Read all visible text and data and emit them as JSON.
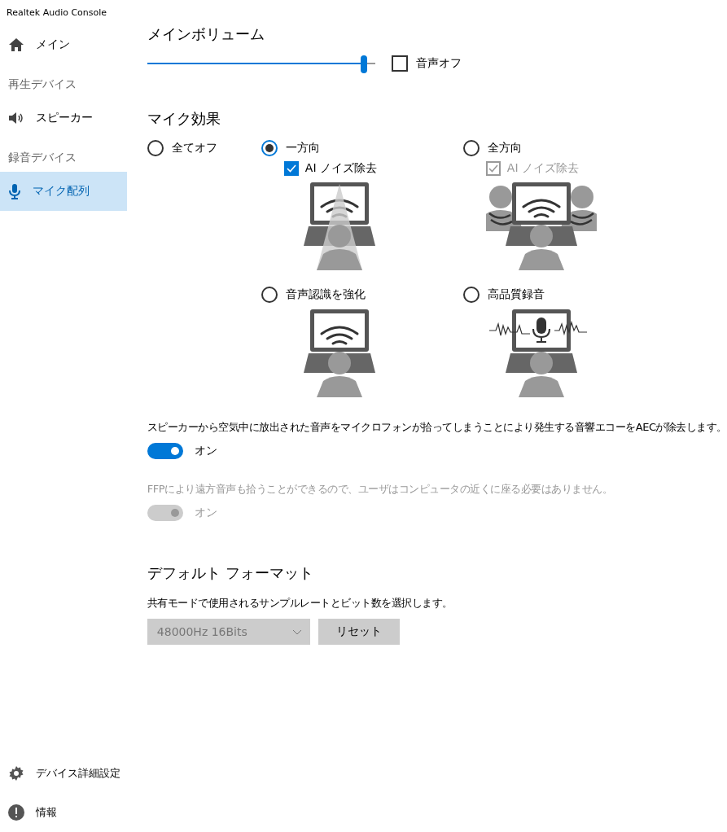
{
  "app_title": "Realtek Audio Console",
  "sidebar": {
    "items": [
      {
        "kind": "nav",
        "label": "メイン",
        "selected": false
      },
      {
        "kind": "header",
        "label": "再生デバイス"
      },
      {
        "kind": "nav",
        "label": "スピーカー",
        "selected": false
      },
      {
        "kind": "header",
        "label": "録音デバイス"
      },
      {
        "kind": "nav",
        "label": "マイク配列",
        "selected": true
      }
    ],
    "bottom_items": [
      {
        "label": "デバイス詳細設定"
      },
      {
        "label": "情報"
      }
    ]
  },
  "main_volume": {
    "title": "メインボリューム",
    "level": 0.95,
    "mute": {
      "label": "音声オフ",
      "checked": false
    }
  },
  "mic_effects": {
    "title": "マイク効果",
    "options": [
      {
        "kind": "plain",
        "label": "全てオフ",
        "selected": false
      },
      {
        "kind": "beam",
        "label": "一方向",
        "selected": true,
        "noise": {
          "label": "AI ノイズ除去",
          "checked": true,
          "disabled": false
        }
      },
      {
        "kind": "group",
        "label": "全方向",
        "selected": false,
        "noise": {
          "label": "AI ノイズ除去",
          "checked": true,
          "disabled": true
        }
      },
      {
        "kind": "waves",
        "label": "音声認識を強化",
        "selected": false
      },
      {
        "kind": "mic",
        "label": "高品質録音",
        "selected": false
      }
    ]
  },
  "toggles": [
    {
      "description": "スピーカーから空気中に放出された音声をマイクロフォンが拾ってしまうことにより発生する音響エコーをAECが除去します。",
      "label": "オン",
      "on": true,
      "disabled": false
    },
    {
      "description": "FFPにより遠方音声も拾うことができるので、ユーザはコンピュータの近くに座る必要はありません。",
      "label": "オン",
      "on": true,
      "disabled": true
    }
  ],
  "default_format": {
    "title": "デフォルト フォーマット",
    "description": "共有モードで使用されるサンプルレートとビット数を選択します。",
    "value": "48000Hz 16Bits",
    "reset": "リセット"
  }
}
